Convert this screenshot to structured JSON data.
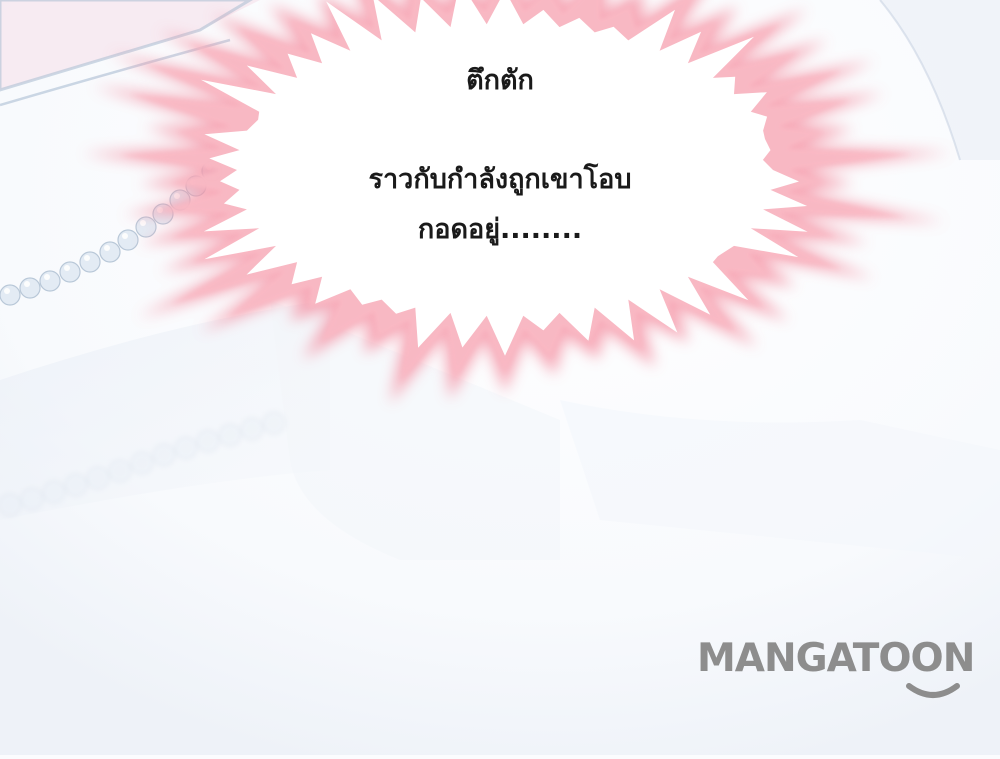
{
  "panel": {
    "sfx": "ตึกตัก",
    "narration_line1": "ราวกับกำลังถูกเขาโอบ",
    "narration_line2": "กอดอยู่........"
  },
  "watermark": {
    "text": "MANGATOON"
  },
  "colors": {
    "burst_outer": "#f28a9a",
    "burst_inner": "#ffffff",
    "background": "#fbfcfe",
    "pearl": "#dde7f1",
    "watermark": "#8d8d8d"
  }
}
